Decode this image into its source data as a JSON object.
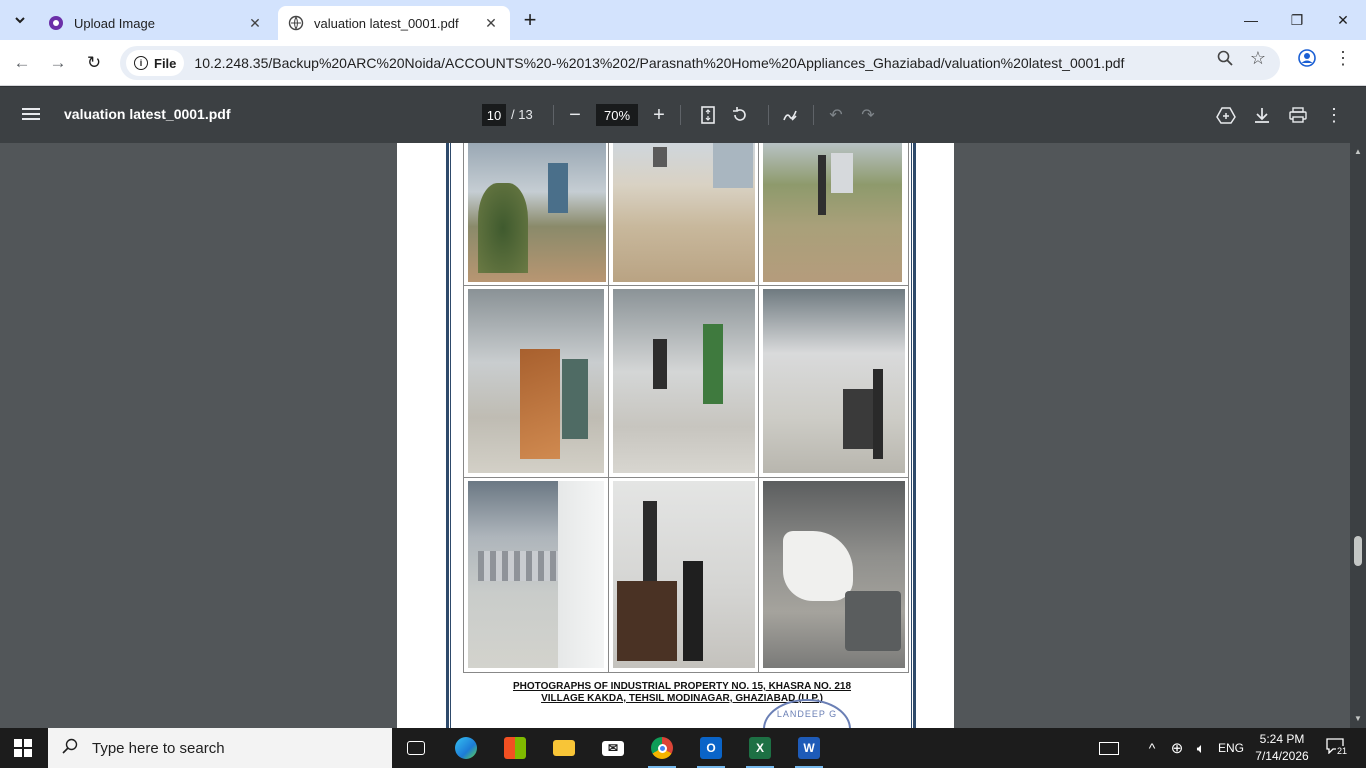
{
  "browser": {
    "tabs": [
      {
        "title": "Upload Image",
        "active": false
      },
      {
        "title": "valuation latest_0001.pdf",
        "active": true
      }
    ],
    "address": {
      "chip_label": "File",
      "url": "10.2.248.35/Backup%20ARC%20Noida/ACCOUNTS%20-%2013%202/Parasnath%20Home%20Appliances_Ghaziabad/valuation%20latest_0001.pdf"
    }
  },
  "pdf": {
    "title": "valuation latest_0001.pdf",
    "current_page": "10",
    "total_pages": "/ 13",
    "zoom": "70%",
    "caption_line1": "PHOTOGRAPHS OF INDUSTRIAL PROPERTY NO. 15, KHASRA NO. 218",
    "caption_line2": "VILLAGE KAKDA, TEHSIL MODINAGAR, GHAZIABAD (U.P.)",
    "stamp_text": "LANDEEP G",
    "scroll_position": 0.72
  },
  "taskbar": {
    "search_placeholder": "Type here to search",
    "language": "ENG",
    "time": "5:24 PM",
    "date": "7/14/2026",
    "notification_count": "21"
  },
  "colors": {
    "tabstrip": "#d3e3fd",
    "pdf_toolbar": "#3c4043",
    "viewer_bg": "#525659",
    "frame_border": "#2e4a6b"
  }
}
